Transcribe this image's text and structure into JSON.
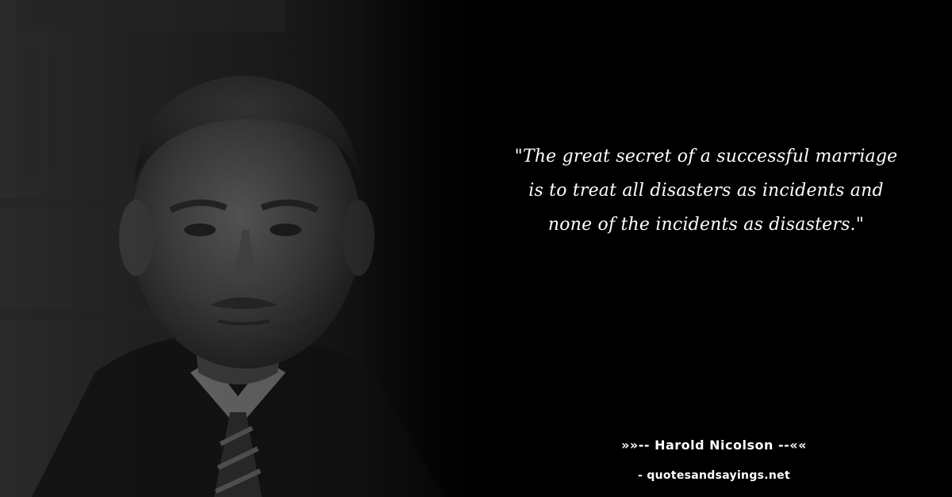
{
  "quote": {
    "text": "\"The great secret of a successful marriage is to treat all disasters as incidents and none of the incidents as disasters.\""
  },
  "attribution": {
    "author_line": "»»-- Harold Nicolson --««",
    "source": "- quotesandsayings.net"
  },
  "colors": {
    "background": "#000000",
    "text": "#ffffff"
  },
  "portrait": {
    "icon": "portrait-photo"
  }
}
